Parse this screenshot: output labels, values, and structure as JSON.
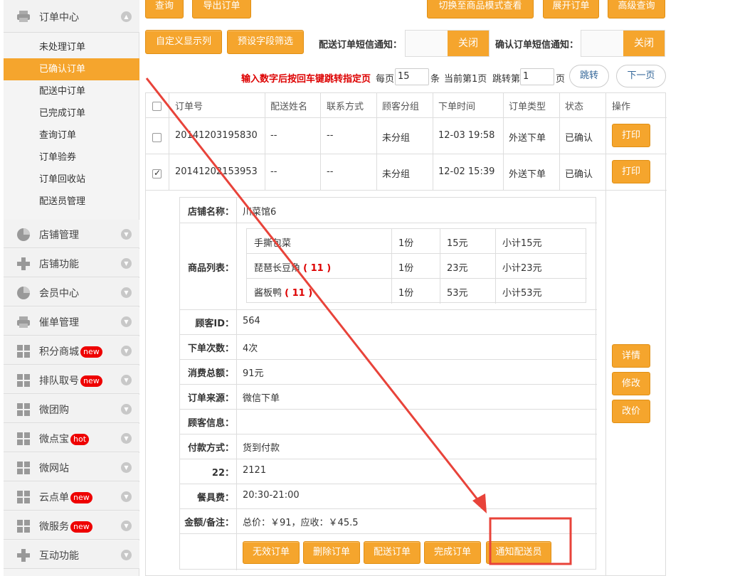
{
  "sidebar": {
    "order_center": "订单中心",
    "sub_items": [
      "未处理订单",
      "已确认订单",
      "配送中订单",
      "已完成订单",
      "查询订单",
      "订单验券",
      "订单回收站",
      "配送员管理"
    ],
    "sections": [
      {
        "label": "店铺管理",
        "icon": "pie-chart-icon"
      },
      {
        "label": "店铺功能",
        "icon": "plus-icon"
      },
      {
        "label": "会员中心",
        "icon": "pie-chart-icon"
      },
      {
        "label": "催单管理",
        "icon": "printer-icon"
      },
      {
        "label": "积分商城",
        "icon": "grid-icon",
        "badge": "new"
      },
      {
        "label": "排队取号",
        "icon": "grid-icon",
        "badge": "new"
      },
      {
        "label": "微团购",
        "icon": "grid-icon"
      },
      {
        "label": "微点宝",
        "icon": "grid-icon",
        "badge": "hot"
      },
      {
        "label": "微网站",
        "icon": "grid-icon"
      },
      {
        "label": "云点单",
        "icon": "grid-icon",
        "badge": "new"
      },
      {
        "label": "微服务",
        "icon": "grid-icon",
        "badge": "new"
      },
      {
        "label": "互动功能",
        "icon": "plus-icon"
      }
    ]
  },
  "toolbar": {
    "query": "查询",
    "export": "导出订单",
    "switch_mode": "切换至商品模式查看",
    "expand": "展开订单",
    "advanced": "高级查询",
    "custom_columns": "自定义显示列",
    "preset_filter": "预设字段筛选",
    "delivery_sms_label": "配送订单短信通知：",
    "delivery_sms_value": "关闭",
    "confirm_sms_label": "确认订单短信通知：",
    "confirm_sms_value": "关闭"
  },
  "pager": {
    "hint": "输入数字后按回车键跳转指定页",
    "per_page": "每页",
    "per_page_value": "15",
    "unit": "条",
    "current": "当前第1页",
    "jump_to": "跳转第",
    "jump_value": "1",
    "page": "页",
    "jump_btn": "跳转",
    "next": "下一页"
  },
  "table": {
    "headers": [
      "订单号",
      "配送姓名",
      "联系方式",
      "顾客分组",
      "下单时间",
      "订单类型",
      "状态",
      "操作"
    ],
    "rows": [
      {
        "id": "20141203195830",
        "name": "--",
        "contact": "--",
        "group": "未分组",
        "time": "12-03 19:58",
        "type": "外送下单",
        "status": "已确认",
        "action": "打印"
      },
      {
        "id": "20141202153953",
        "name": "--",
        "contact": "--",
        "group": "未分组",
        "time": "12-02 15:39",
        "type": "外送下单",
        "status": "已确认",
        "action": "打印"
      }
    ]
  },
  "detail": {
    "shop_label": "店铺名称：",
    "shop_value": "川菜馆6",
    "goods_label": "商品列表：",
    "goods": [
      {
        "name": "手撕包菜",
        "tag": "",
        "qty": "1份",
        "price": "15元",
        "subtotal": "小计15元"
      },
      {
        "name": "琵琶长豆角",
        "tag": "( 11 )",
        "qty": "1份",
        "price": "23元",
        "subtotal": "小计23元"
      },
      {
        "name": "酱板鸭",
        "tag": "( 11 )",
        "qty": "1份",
        "price": "53元",
        "subtotal": "小计53元"
      }
    ],
    "fields": [
      {
        "label": "顾客ID：",
        "value": "564"
      },
      {
        "label": "下单次数：",
        "value": "4次"
      },
      {
        "label": "消费总额：",
        "value": "91元"
      },
      {
        "label": "订单来源：",
        "value": "微信下单"
      },
      {
        "label": "顾客信息：",
        "value": ""
      },
      {
        "label": "付款方式：",
        "value": "货到付款"
      },
      {
        "label": "22：",
        "value": "2121"
      },
      {
        "label": "餐具费：",
        "value": "20:30-21:00"
      },
      {
        "label": "金额/备注：",
        "value": "总价：￥91，应收：￥45.5"
      }
    ],
    "actions": [
      "无效订单",
      "删除订单",
      "配送订单",
      "完成订单",
      "通知配送员"
    ],
    "side_buttons": [
      "详情",
      "修改",
      "改价"
    ]
  },
  "colors": {
    "accent": "#f5a52d",
    "annotation": "#e8433a"
  }
}
